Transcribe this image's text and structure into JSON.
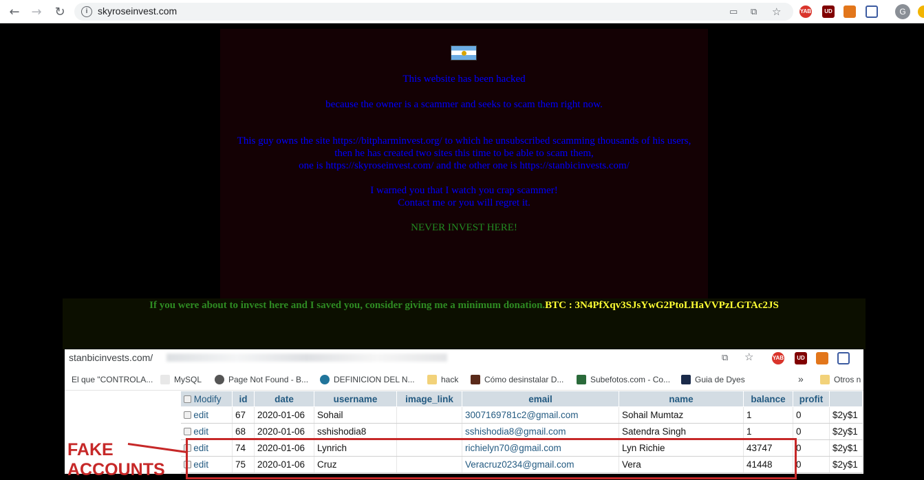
{
  "browser": {
    "url": "skyroseinvest.com",
    "back_icon": "←",
    "forward_icon": "→",
    "reload_icon": "↻",
    "avatar_letter": "G",
    "ext_labels": [
      "YAB",
      "UD"
    ]
  },
  "hacked_page": {
    "headline": "This website has been hacked",
    "reason": "because the owner is a scammer and seeks to scam them right now.",
    "story_line1": "This guy owns the site https://bitpharminvest.org/ to which he unsubscribed scamming thousands of his users,",
    "story_line2": "then he has created two sites this time to be able to scam them,",
    "story_line3": "one is https://skyroseinvest.com/ and the other one is https://stanbicinvests.com/",
    "warning_line1": "I warned you that I watch you crap scammer!",
    "warning_line2": "Contact me or you will regret it.",
    "never_invest": "NEVER INVEST HERE!",
    "donation_text": "If you were about to invest here and I saved you, consider giving me a minimum donation.",
    "btc_text": "BTC : 3N4PfXqv3SJsYwG2PtoLHaVVPzLGTAc2JS"
  },
  "embedded_screenshot": {
    "url_prefix": "stanbicinvests.com/",
    "bookmarks": [
      "El que \"CONTROLA...",
      "MySQL",
      "Page Not Found - B...",
      "DEFINICION DEL N...",
      "hack",
      "Cómo desinstalar D...",
      "Subefotos.com - Co...",
      "Guia de Dyes",
      "»",
      "Otros n"
    ],
    "table": {
      "headers": [
        "Modify",
        "id",
        "date",
        "username",
        "image_link",
        "email",
        "name",
        "balance",
        "profit"
      ],
      "rows": [
        {
          "edit": "edit",
          "id": "67",
          "date": "2020-01-06",
          "username": "Sohail",
          "image_link": "",
          "email": "3007169781c2@gmail.com",
          "name": "Sohail Mumtaz",
          "balance": "1",
          "profit": "0",
          "extra": "$2y$1"
        },
        {
          "edit": "edit",
          "id": "68",
          "date": "2020-01-06",
          "username": "sshishodia8",
          "image_link": "",
          "email": "sshishodia8@gmail.com",
          "name": "Satendra Singh",
          "balance": "1",
          "profit": "0",
          "extra": "$2y$1"
        },
        {
          "edit": "edit",
          "id": "74",
          "date": "2020-01-06",
          "username": "Lynrich",
          "image_link": "",
          "email": "richielyn70@gmail.com",
          "name": "Lyn Richie",
          "balance": "43747",
          "profit": "0",
          "extra": "$2y$1"
        },
        {
          "edit": "edit",
          "id": "75",
          "date": "2020-01-06",
          "username": "Cruz",
          "image_link": "",
          "email": "Veracruz0234@gmail.com",
          "name": "Vera",
          "balance": "41448",
          "profit": "0",
          "extra": "$2y$1"
        }
      ]
    },
    "annotation_line1": "FAKE",
    "annotation_line2": "ACCOUNTS"
  },
  "colors": {
    "link_blue": "#0000ff",
    "never_green": "#228b22",
    "btc_yellow": "#ffff33",
    "annotation_red": "#c62828"
  }
}
